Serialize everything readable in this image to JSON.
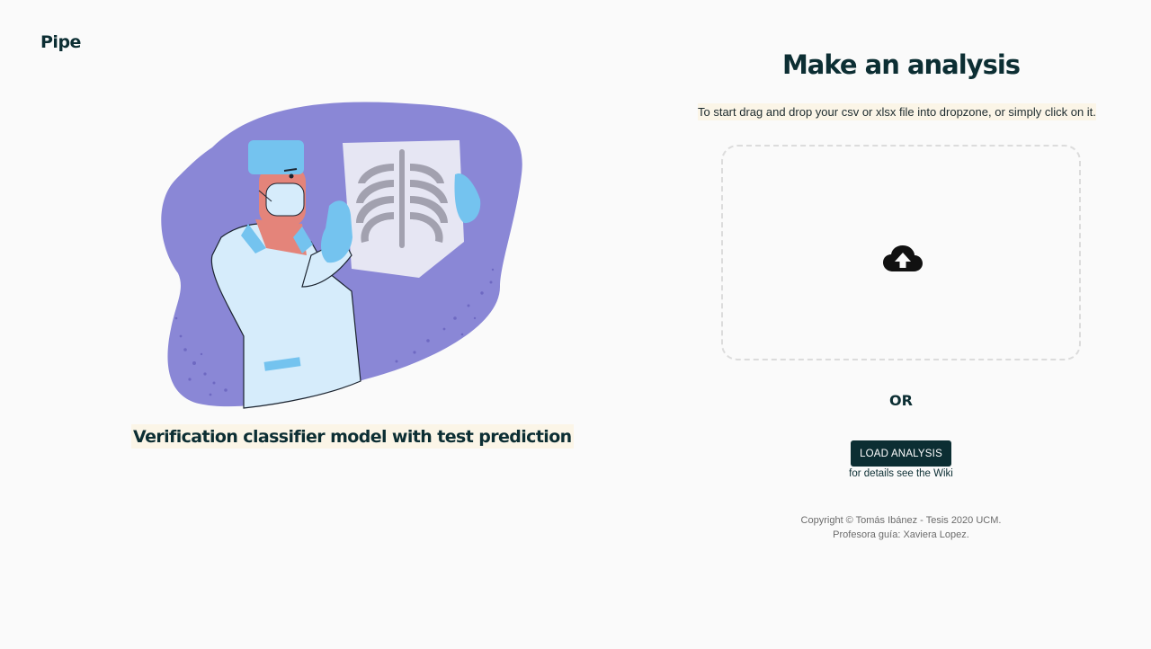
{
  "app": {
    "brand": "Pipe"
  },
  "hero": {
    "illustration": "doctor-examining-chest-xray-illustration",
    "tagline": "Verification classifier model with test prediction"
  },
  "analysis": {
    "title": "Make an analysis",
    "instructions": "To start drag and drop your csv or xlsx file into dropzone, or simply click on it.",
    "dropzone_icon": "cloud-upload-icon",
    "or_label": "OR",
    "load_button": "LOAD ANALYSIS",
    "wiki_note": "for details see the Wiki"
  },
  "footer": {
    "copyright": "Copyright © Tomás Ibánez - Tesis 2020 UCM.",
    "advisor": "Profesora guía: Xaviera Lopez."
  },
  "colors": {
    "primary": "#0c2e33",
    "highlight": "#fbf5e7",
    "blob": "#8a87d6",
    "glove": "#74c3ef"
  }
}
